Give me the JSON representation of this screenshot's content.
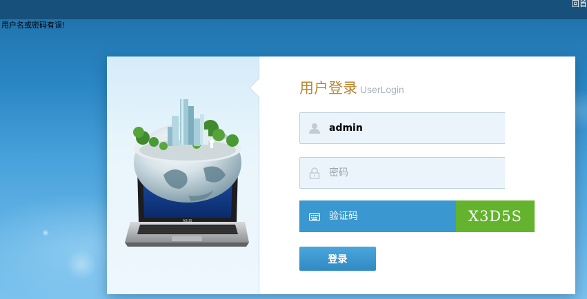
{
  "header": {
    "top_link": "回首"
  },
  "message": {
    "error": "用户名或密码有误!"
  },
  "login": {
    "title_cn": "用户登录",
    "title_en": "UserLogin",
    "username": {
      "value": "admin",
      "icon": "user-icon"
    },
    "password": {
      "placeholder": "密码",
      "value": "",
      "icon": "lock-icon"
    },
    "captcha": {
      "placeholder": "验证码",
      "value": "",
      "icon": "keyboard-icon",
      "code": "X3D5S"
    },
    "submit_label": "登录",
    "laptop_brand": "ASUS"
  },
  "colors": {
    "topbar": "#17507a",
    "title": "#b8862f",
    "captcha_field": "#3a97cf",
    "captcha_code_bg": "#64b32e",
    "button": "#3a97cf"
  }
}
